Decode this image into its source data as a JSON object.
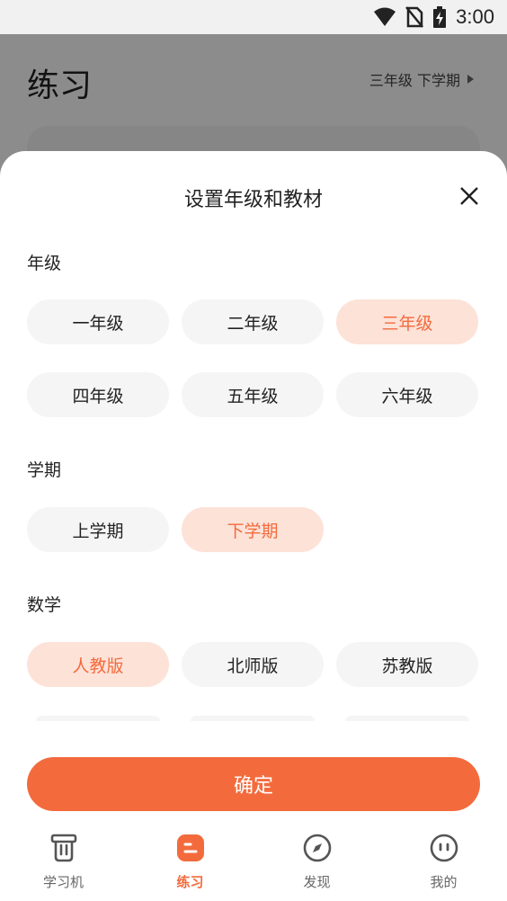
{
  "status_bar": {
    "time": "3:00"
  },
  "background": {
    "title": "练习",
    "grade_link": "三年级 下学期"
  },
  "sheet": {
    "title": "设置年级和教材",
    "sections": {
      "grade": {
        "label": "年级",
        "options": [
          "一年级",
          "二年级",
          "三年级",
          "四年级",
          "五年级",
          "六年级"
        ],
        "selected": "三年级"
      },
      "term": {
        "label": "学期",
        "options": [
          "上学期",
          "下学期"
        ],
        "selected": "下学期"
      },
      "math": {
        "label": "数学",
        "options": [
          "人教版",
          "北师版",
          "苏教版"
        ],
        "selected": "人教版"
      }
    },
    "confirm_label": "确定"
  },
  "tabbar": {
    "items": [
      {
        "label": "学习机",
        "icon": "learning-machine-icon"
      },
      {
        "label": "练习",
        "icon": "practice-icon"
      },
      {
        "label": "发现",
        "icon": "compass-icon"
      },
      {
        "label": "我的",
        "icon": "profile-face-icon"
      }
    ],
    "active": "练习"
  },
  "colors": {
    "accent": "#f36b3d",
    "chip_selected_bg": "#fde2d8",
    "chip_bg": "#f5f5f5"
  }
}
